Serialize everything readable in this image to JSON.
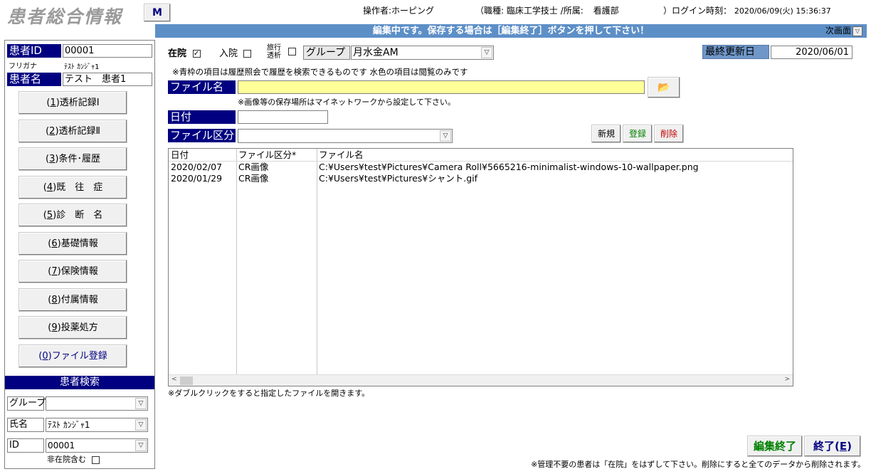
{
  "app_title": "患者総合情報",
  "m_button": "M",
  "header": {
    "operator_label": "操作者:",
    "operator": "ホーピング",
    "job_prefix": "（職種:",
    "job": "臨床工学技士",
    "dept_label": "/所属:",
    "dept": "看護部",
    "login_label": "）ログイン時刻：",
    "login_time": "2020/06/09(火) 15:36:37"
  },
  "left": {
    "patient_id_label": "患者ID",
    "patient_id": "00001",
    "furigana_label": "フリガナ",
    "furigana": "ﾃｽﾄ ｶﾝｼﾞｬ1",
    "patient_name_label": "患者名",
    "patient_name": "テスト　患者1",
    "nav": [
      {
        "prefix": "(",
        "key": "1",
        "suffix": ")透析記録Ⅰ"
      },
      {
        "prefix": "(",
        "key": "2",
        "suffix": ")透析記録Ⅱ"
      },
      {
        "prefix": "(",
        "key": "3",
        "suffix": ")条件･履歴"
      },
      {
        "prefix": "(",
        "key": "4",
        "suffix": ")既　往　症"
      },
      {
        "prefix": "(",
        "key": "5",
        "suffix": ")診　断　名"
      },
      {
        "prefix": "(",
        "key": "6",
        "suffix": ")基礎情報"
      },
      {
        "prefix": "(",
        "key": "7",
        "suffix": ")保険情報"
      },
      {
        "prefix": "(",
        "key": "8",
        "suffix": ")付属情報"
      },
      {
        "prefix": "(",
        "key": "9",
        "suffix": ")投薬処方"
      },
      {
        "prefix": "(",
        "key": "0",
        "suffix": ")ファイル登録"
      }
    ],
    "search": {
      "title": "患者検索",
      "group_label": "グループ",
      "group_value": "",
      "name_label": "氏名",
      "name_value": "ﾃｽﾄ ｶﾝｼﾞｬ1",
      "id_label": "ID",
      "id_value": "00001",
      "include_inactive": "非在院含む"
    }
  },
  "main": {
    "banner": "編集中です。保存する場合は［編集終了］ボタンを押して下さい！",
    "next_screen": "次画面",
    "in_hospital_label": "在院",
    "in_hospital_checked": "✓",
    "admitted_label": "入院",
    "travel_line1": "旅行",
    "travel_line2": "透析",
    "group_label": "グループ",
    "group_value": "月水金AM",
    "last_update_label": "最終更新日",
    "last_update": "2020/06/01",
    "note_top": "※青枠の項目は履歴照会で履歴を検索できるものです 水色の項目は閲覧のみです",
    "file_name_label": "ファイル名",
    "file_name_value": "",
    "storage_note": "※画像等の保存場所はマイネットワークから設定して下さい。",
    "date_label": "日付",
    "date_value": "",
    "file_type_label": "ファイル区分",
    "file_type_value": "",
    "btn_new": "新規",
    "btn_register": "登録",
    "btn_delete": "削除",
    "list": {
      "headers": [
        "日付",
        "ファイル区分*",
        "ファイル名"
      ],
      "rows": [
        {
          "date": "2020/02/07",
          "type": "CR画像",
          "file": "C:¥Users¥test¥Pictures¥Camera Roll¥5665216-minimalist-windows-10-wallpaper.png"
        },
        {
          "date": "2020/01/29",
          "type": "CR画像",
          "file": "C:¥Users¥test¥Pictures¥シャント.gif"
        }
      ]
    },
    "double_click_note": "※ダブルクリックをすると指定したファイルを開きます。",
    "btn_end_edit": "編集終了",
    "btn_exit_label": "終了(",
    "btn_exit_key": "E",
    "btn_exit_suffix": ")",
    "bottom_note": "※管理不要の患者は「在院」をはずして下さい。削除にすると全てのデータから削除されます。"
  },
  "colors": {
    "navy": "#000080",
    "banner_blue": "#5d8fc7",
    "label_blue": "#6f97c8",
    "yellow_field": "#ffff99",
    "green_text": "#008000",
    "red_text": "#c00000"
  }
}
